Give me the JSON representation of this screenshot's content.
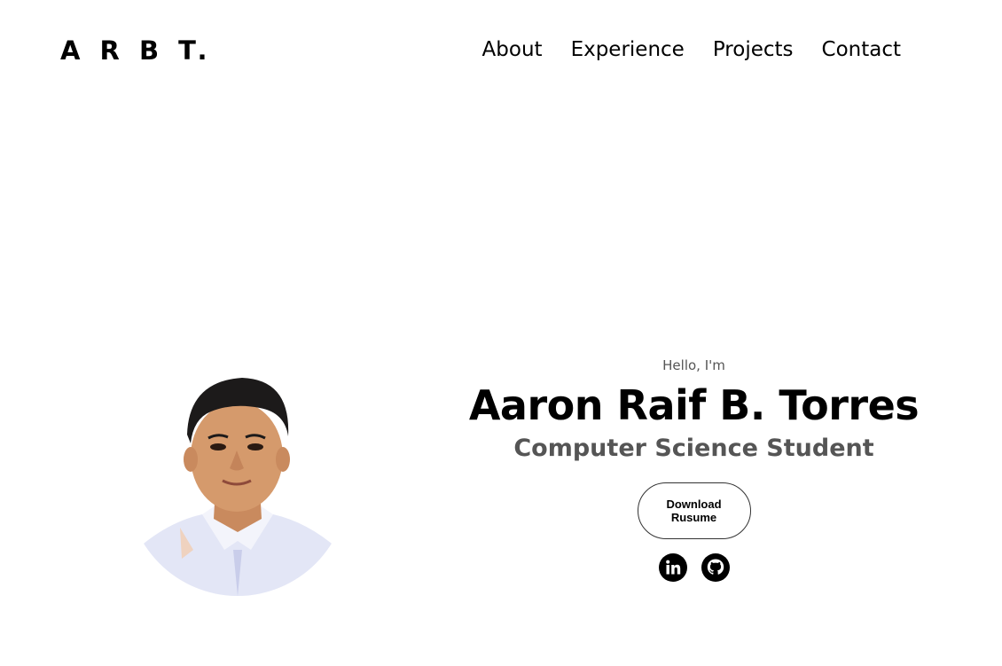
{
  "header": {
    "logo": "A R B T.",
    "nav": [
      {
        "label": "About"
      },
      {
        "label": "Experience"
      },
      {
        "label": "Projects"
      },
      {
        "label": "Contact"
      }
    ]
  },
  "hero": {
    "greeting": "Hello, I'm",
    "name": "Aaron Raif B. Torres",
    "role": "Computer Science Student",
    "resume_button": "Download Rusume",
    "socials": [
      {
        "icon": "linkedin-icon"
      },
      {
        "icon": "github-icon"
      }
    ]
  },
  "colors": {
    "text": "#000000",
    "muted": "#555555",
    "background": "#ffffff"
  }
}
